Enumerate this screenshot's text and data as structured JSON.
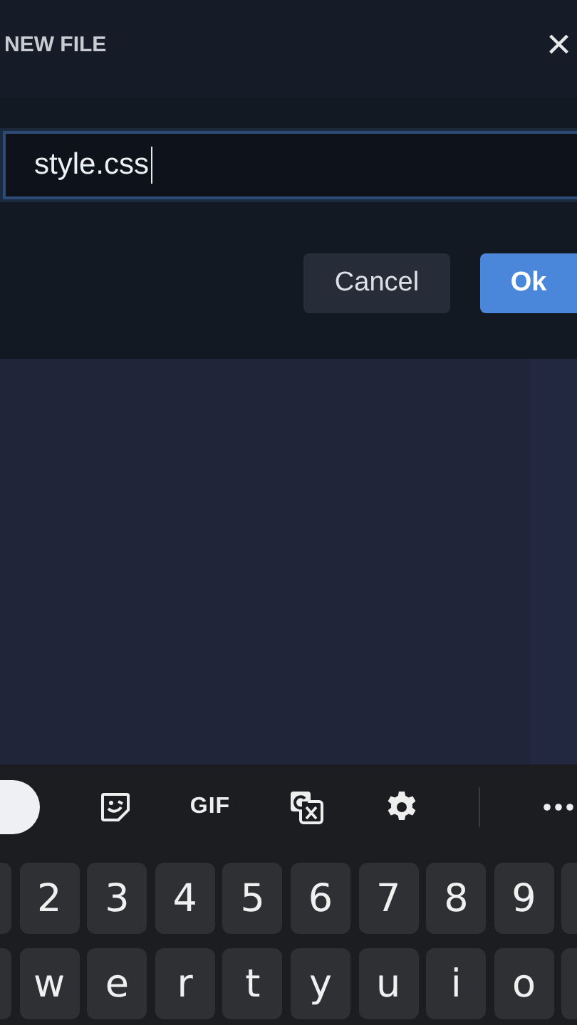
{
  "dialog": {
    "title": "NEW FILE",
    "close": "×",
    "input": {
      "value": "style.css"
    },
    "buttons": [
      {
        "label": "Cancel",
        "kind": "secondary"
      },
      {
        "label": "Ok",
        "kind": "primary"
      }
    ]
  },
  "keyboard": {
    "toolbar": [
      {
        "kind": "sticker"
      },
      {
        "kind": "text",
        "label": "GIF"
      },
      {
        "kind": "translate"
      },
      {
        "kind": "settings"
      },
      {
        "kind": "divider"
      },
      {
        "kind": "more"
      }
    ],
    "rows": [
      [
        "2",
        "3",
        "4",
        "5",
        "6",
        "7",
        "8",
        "9"
      ],
      [
        "w",
        "e",
        "r",
        "t",
        "y",
        "u",
        "i",
        "o"
      ]
    ]
  }
}
